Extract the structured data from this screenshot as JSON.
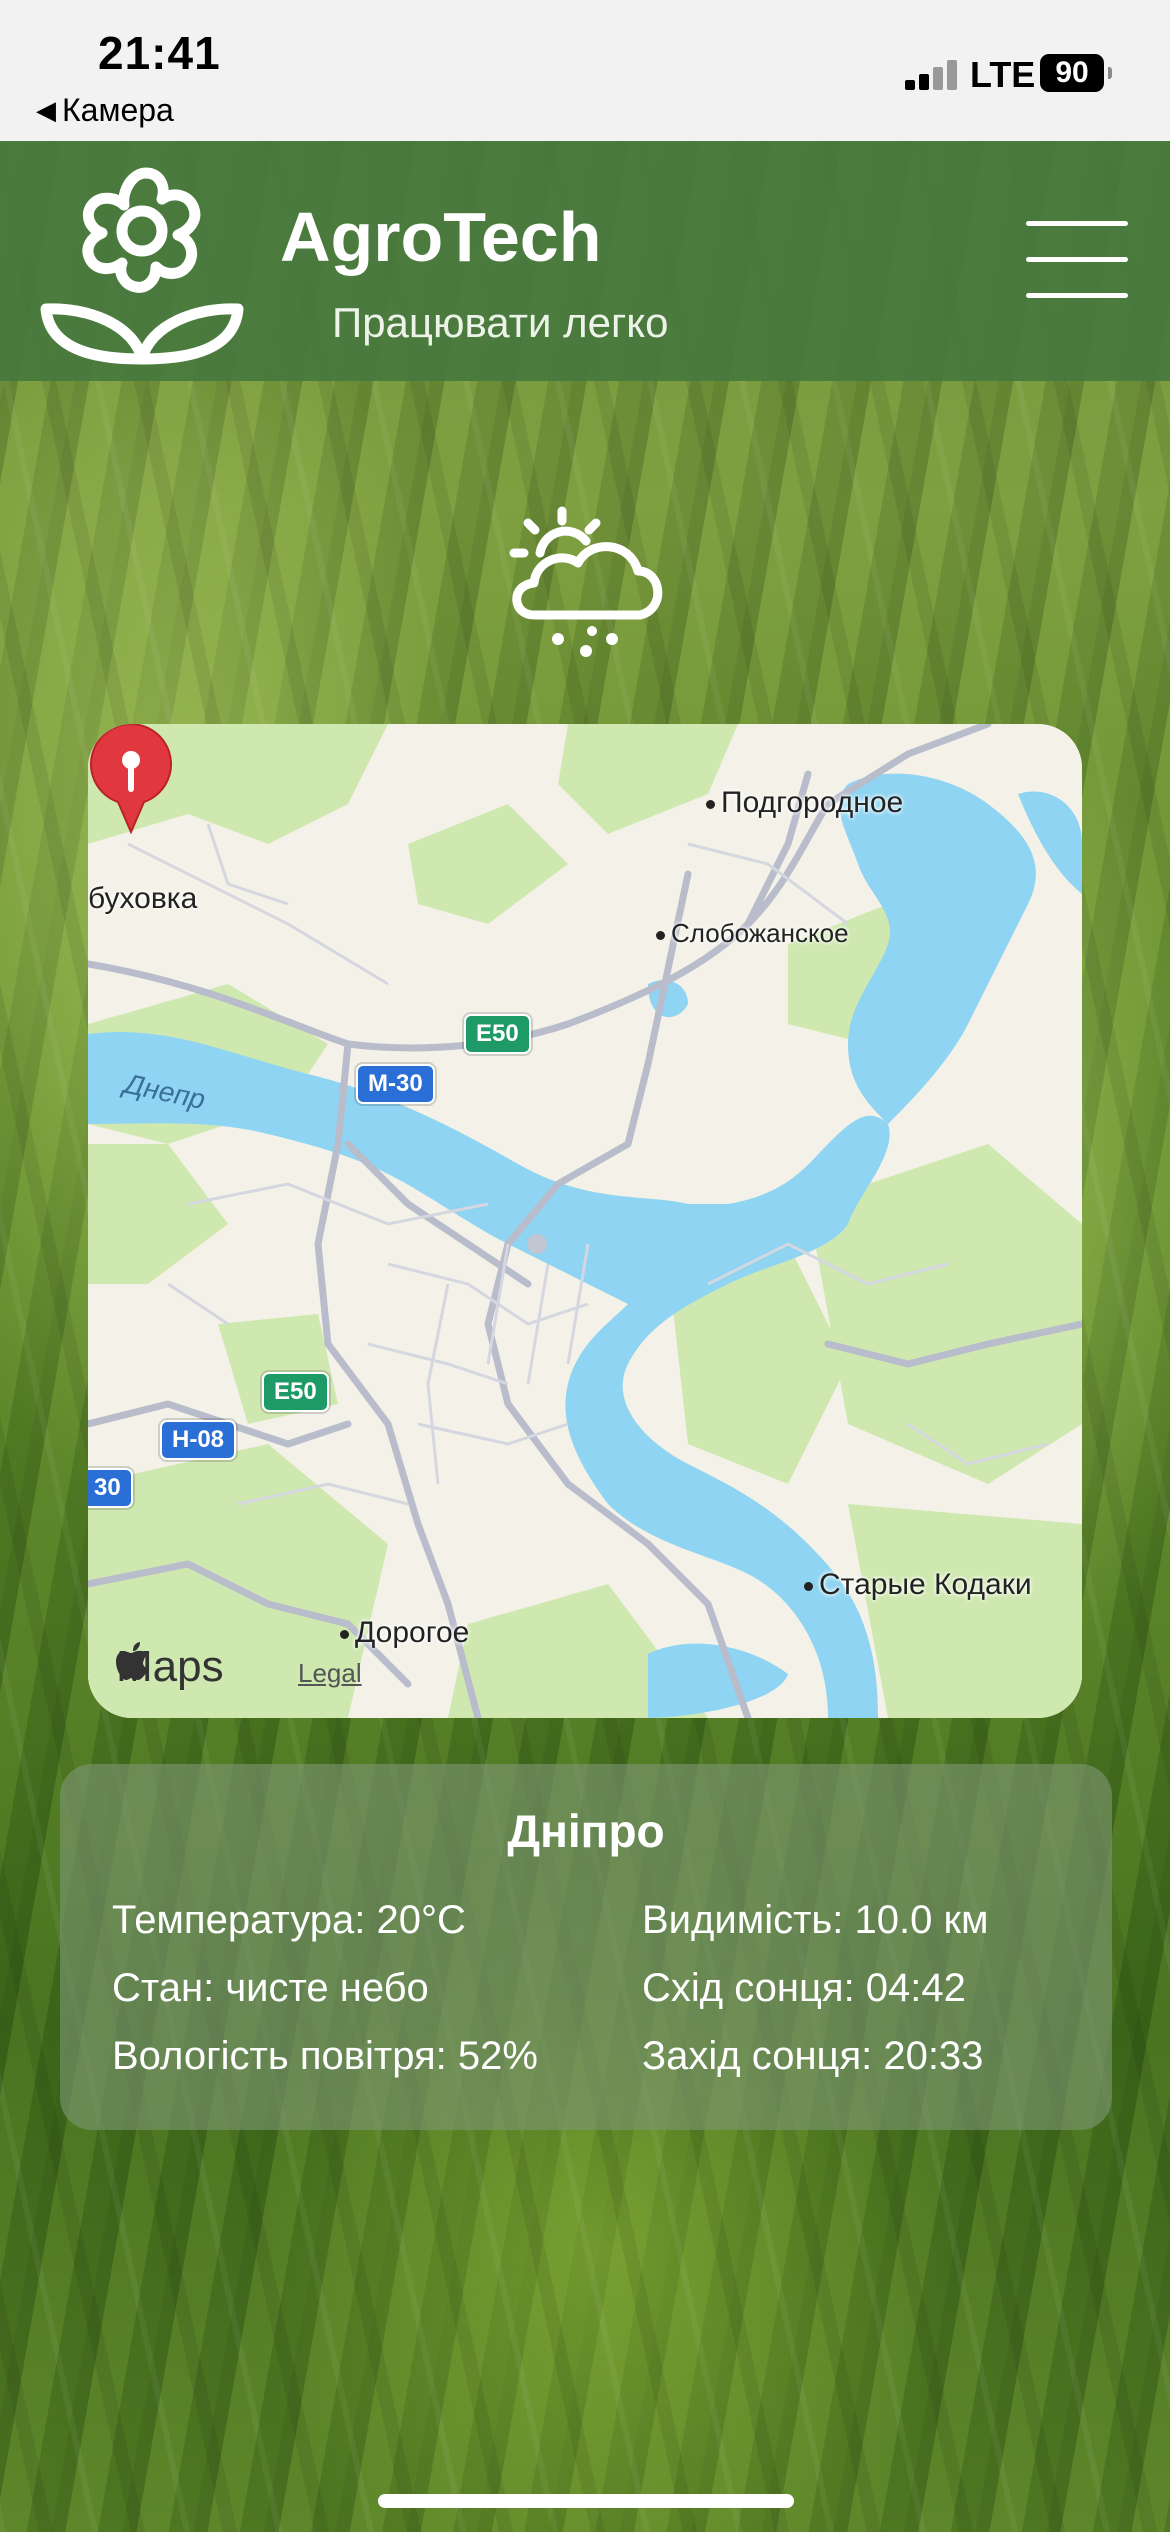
{
  "status_bar": {
    "time": "21:41",
    "back_label": "Камера",
    "network": "LTE",
    "battery": "90"
  },
  "header": {
    "brand": "AgroTech",
    "slogan": "Працювати легко",
    "logo_icon": "flower-icon",
    "menu_icon": "hamburger-menu-icon"
  },
  "weather": {
    "icon": "sun-cloud-snow-icon"
  },
  "map": {
    "places": [
      {
        "name": "Подгородное"
      },
      {
        "name": "Слобожанское"
      },
      {
        "name": "буховка"
      },
      {
        "name": "Старые Кодаки"
      },
      {
        "name": "Дорогое"
      }
    ],
    "river": "Днепр",
    "road_shields": [
      "E50",
      "M-30",
      "E50",
      "H-08",
      "30"
    ],
    "brand": "Maps",
    "legal": "Legal"
  },
  "info": {
    "city": "Дніпро",
    "left": [
      "Температура: 20°C",
      "Стан: чисте небо",
      "Вологість повітря: 52%"
    ],
    "right": [
      "Видимість: 10.0 км",
      "Схід сонця: 04:42",
      "Захід сонця: 20:33"
    ]
  },
  "colors": {
    "header_bg": "#48783e",
    "water": "#8fd4f2",
    "park": "#cfe8b0",
    "pin": "#e0383e"
  }
}
